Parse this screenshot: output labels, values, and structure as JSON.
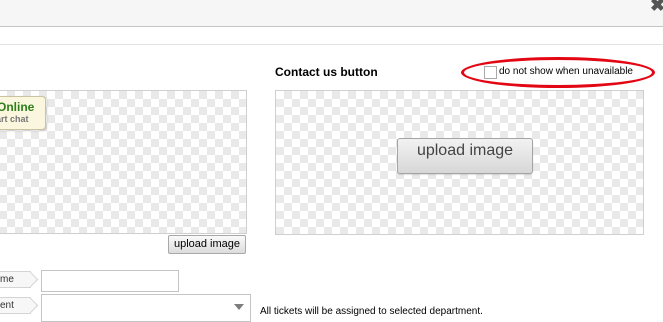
{
  "window": {
    "close_icon": "close-icon"
  },
  "left_panel": {
    "badge_online": "Online",
    "badge_chat": "art chat",
    "upload_label": "upload image"
  },
  "right_panel": {
    "title": "Contact us button",
    "checkbox_label": "do not show when unavailable",
    "upload_label": "upload image"
  },
  "form": {
    "name_label": "me",
    "department_label": "ent",
    "name_value": "",
    "department_selected": "",
    "department_note": "All tickets will be assigned to selected department."
  },
  "colors": {
    "online_green": "#2d7f1a",
    "highlight_red": "#e30613",
    "checker_gray": "#e9e9e9"
  }
}
